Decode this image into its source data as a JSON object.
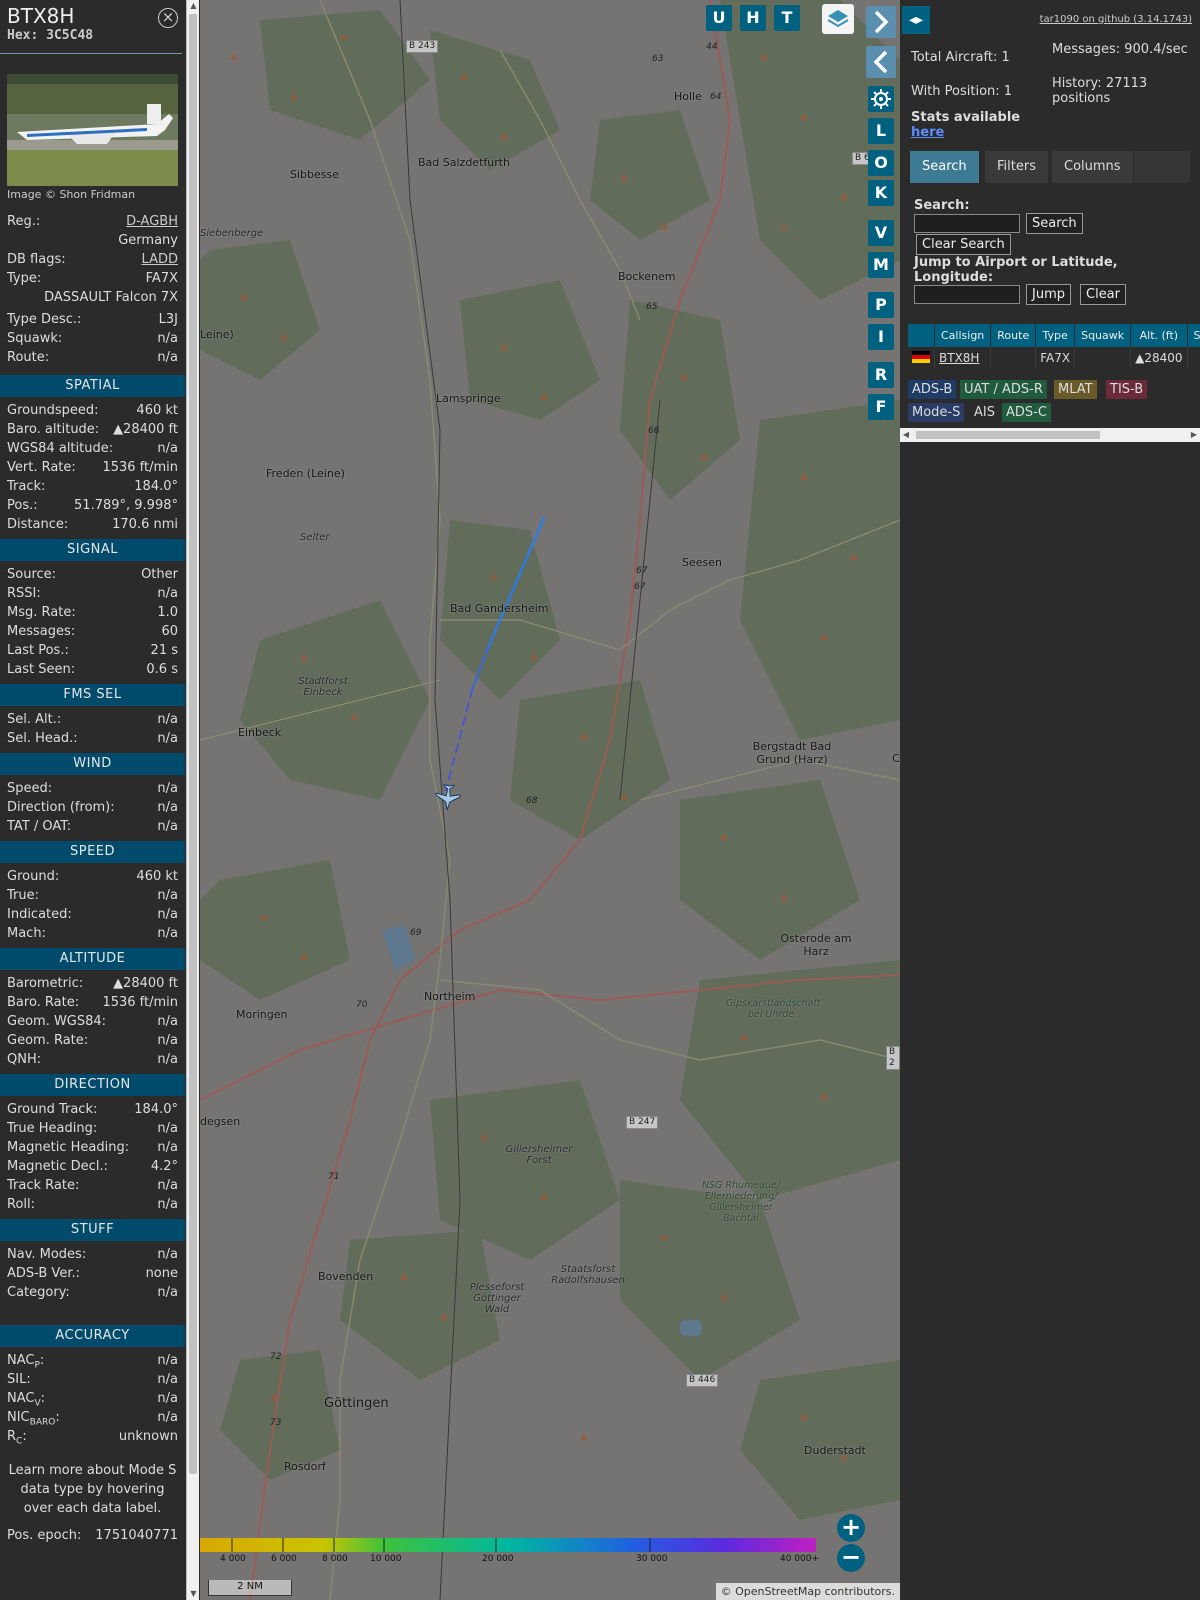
{
  "aircraft": {
    "callsign": "BTX8H",
    "hex": "Hex: 3C5C48",
    "image_credit": "Image © Shon Fridman",
    "registration_key": "Reg.:",
    "registration": "D-AGBH",
    "country": "Germany",
    "dbflags_key": "DB flags:",
    "dbflags": "LADD",
    "type_key": "Type:",
    "type": "FA7X",
    "type_name": "DASSAULT Falcon 7X",
    "type_desc_key": "Type Desc.:",
    "type_desc": "L3J",
    "squawk_key": "Squawk:",
    "squawk": "n/a",
    "route_key": "Route:",
    "route": "n/a"
  },
  "sections": {
    "spatial": {
      "title": "SPATIAL",
      "rows": [
        {
          "k": "Groundspeed:",
          "v": "460 kt"
        },
        {
          "k": "Baro. altitude:",
          "v": "▲28400 ft"
        },
        {
          "k": "WGS84 altitude:",
          "v": "n/a"
        },
        {
          "k": "Vert. Rate:",
          "v": "1536 ft/min"
        },
        {
          "k": "Track:",
          "v": "184.0°"
        },
        {
          "k": "Pos.:",
          "v": "51.789°, 9.998°"
        },
        {
          "k": "Distance:",
          "v": "170.6 nmi"
        }
      ]
    },
    "signal": {
      "title": "SIGNAL",
      "rows": [
        {
          "k": "Source:",
          "v": "Other"
        },
        {
          "k": "RSSI:",
          "v": "n/a"
        },
        {
          "k": "Msg. Rate:",
          "v": "1.0"
        },
        {
          "k": "Messages:",
          "v": "60"
        },
        {
          "k": "Last Pos.:",
          "v": "21 s"
        },
        {
          "k": "Last Seen:",
          "v": "0.6 s"
        }
      ]
    },
    "fms": {
      "title": "FMS SEL",
      "rows": [
        {
          "k": "Sel. Alt.:",
          "v": "n/a"
        },
        {
          "k": "Sel. Head.:",
          "v": "n/a"
        }
      ]
    },
    "wind": {
      "title": "WIND",
      "rows": [
        {
          "k": "Speed:",
          "v": "n/a"
        },
        {
          "k": "Direction (from):",
          "v": "n/a"
        },
        {
          "k": "TAT / OAT:",
          "v": "n/a"
        }
      ]
    },
    "speed": {
      "title": "SPEED",
      "rows": [
        {
          "k": "Ground:",
          "v": "460 kt"
        },
        {
          "k": "True:",
          "v": "n/a"
        },
        {
          "k": "Indicated:",
          "v": "n/a"
        },
        {
          "k": "Mach:",
          "v": "n/a"
        }
      ]
    },
    "altitude": {
      "title": "ALTITUDE",
      "rows": [
        {
          "k": "Barometric:",
          "v": "▲28400 ft"
        },
        {
          "k": "Baro. Rate:",
          "v": "1536 ft/min"
        },
        {
          "k": "Geom. WGS84:",
          "v": "n/a"
        },
        {
          "k": "Geom. Rate:",
          "v": "n/a"
        },
        {
          "k": "QNH:",
          "v": "n/a"
        }
      ]
    },
    "direction": {
      "title": "DIRECTION",
      "rows": [
        {
          "k": "Ground Track:",
          "v": "184.0°"
        },
        {
          "k": "True Heading:",
          "v": "n/a"
        },
        {
          "k": "Magnetic Heading:",
          "v": "n/a"
        },
        {
          "k": "Magnetic Decl.:",
          "v": "4.2°"
        },
        {
          "k": "Track Rate:",
          "v": "n/a"
        },
        {
          "k": "Roll:",
          "v": "n/a"
        }
      ]
    },
    "stuff": {
      "title": "STUFF",
      "rows": [
        {
          "k": "Nav. Modes:",
          "v": "n/a"
        },
        {
          "k": "ADS-B Ver.:",
          "v": "none"
        },
        {
          "k": "Category:",
          "v": "n/a"
        }
      ]
    },
    "accuracy": {
      "title": "ACCURACY",
      "rows": [
        {
          "k": "NAC",
          "sub": "P",
          "tail": ":",
          "v": "n/a"
        },
        {
          "k": "SIL:",
          "sub": "",
          "tail": "",
          "v": "n/a"
        },
        {
          "k": "NAC",
          "sub": "V",
          "tail": ":",
          "v": "n/a"
        },
        {
          "k": "NIC",
          "sub": "BARO",
          "tail": ":",
          "v": "n/a"
        },
        {
          "k": "R",
          "sub": "C",
          "tail": ":",
          "v": "unknown"
        }
      ]
    }
  },
  "learn_more": "Learn more about Mode S data type by hovering over each data label.",
  "pos_epoch_key": "Pos. epoch:",
  "pos_epoch": "1751040771",
  "map": {
    "buttons_top": [
      "U",
      "H",
      "T"
    ],
    "buttons_side": [
      "L",
      "O",
      "K",
      "V",
      "M",
      "P",
      "I",
      "R",
      "F"
    ],
    "places": [
      {
        "name": "Holle",
        "cls": ""
      },
      {
        "name": "Bad Salzdetfurth",
        "cls": ""
      },
      {
        "name": "Sibbesse",
        "cls": ""
      },
      {
        "name": "Siebenberge",
        "cls": "italic"
      },
      {
        "name": "Bockenem",
        "cls": ""
      },
      {
        "name": "Leine)",
        "cls": ""
      },
      {
        "name": "Lamspringe",
        "cls": ""
      },
      {
        "name": "Freden (Leine)",
        "cls": ""
      },
      {
        "name": "Selter",
        "cls": "italic"
      },
      {
        "name": "Seesen",
        "cls": ""
      },
      {
        "name": "Bad Gandersheim",
        "cls": ""
      },
      {
        "name": "Stadtforst Einbeck",
        "cls": "italic"
      },
      {
        "name": "Einbeck",
        "cls": ""
      },
      {
        "name": "Bergstadt Bad Grund (Harz)",
        "cls": ""
      },
      {
        "name": "Osterode am Harz",
        "cls": ""
      },
      {
        "name": "Northeim",
        "cls": ""
      },
      {
        "name": "Moringen",
        "cls": ""
      },
      {
        "name": "Gipskarstlandschaft bei Uhrde",
        "cls": "green"
      },
      {
        "name": "degsen",
        "cls": ""
      },
      {
        "name": "Gillersheimer Forst",
        "cls": "italic"
      },
      {
        "name": "NSG Rhumeaue/ Ellerniederung/ Gillersheimer Bachtal",
        "cls": "green"
      },
      {
        "name": "Staatsforst Radolfshausen",
        "cls": "italic"
      },
      {
        "name": "Plesseforst Göttinger Wald",
        "cls": "italic"
      },
      {
        "name": "Bovenden",
        "cls": ""
      },
      {
        "name": "Göttingen",
        "cls": "big"
      },
      {
        "name": "Rosdorf",
        "cls": ""
      },
      {
        "name": "Duderstadt",
        "cls": ""
      },
      {
        "name": "C",
        "cls": ""
      }
    ],
    "roads": [
      "B 243",
      "B 6",
      "B 247",
      "B 446",
      "B 2"
    ],
    "road_numbers": [
      "63",
      "64",
      "65",
      "66",
      "67",
      "67",
      "68",
      "69",
      "70",
      "71",
      "72",
      "73",
      "44"
    ],
    "alt_labels": [
      "4 000",
      "6 000",
      "8 000",
      "10 000",
      "20 000",
      "30 000",
      "40 000+"
    ],
    "scale": "2 NM",
    "attribution": "© OpenStreetMap contributors."
  },
  "right": {
    "github": "tar1090 on github (3.14.1743)",
    "total_aircraft": "Total Aircraft: 1",
    "with_position": "With Position: 1",
    "messages": "Messages: 900.4/sec",
    "history": "History: 27113 positions",
    "stats": "Stats available",
    "stats_link": "here",
    "tabs": [
      "Search",
      "Filters",
      "Columns"
    ],
    "search_label": "Search:",
    "search_button": "Search",
    "clear_search_button": "Clear Search",
    "jump_label": "Jump to Airport or Latitude, Longitude:",
    "jump_button": "Jump",
    "clear_button": "Clear",
    "table_headers": [
      "",
      "Callsign",
      "Route",
      "Type",
      "Squawk",
      "Alt. (ft)",
      "Spd"
    ],
    "table_row": {
      "callsign": "BTX8H",
      "route": "",
      "type": "FA7X",
      "squawk": "",
      "alt": "▲28400",
      "spd": ""
    },
    "legend": [
      {
        "label": "ADS-B",
        "color": "#1e3c66"
      },
      {
        "label": "UAT / ADS-R",
        "color": "#1f5b3c"
      },
      {
        "label": "MLAT",
        "color": "#6a5a2a"
      },
      {
        "label": "TIS-B",
        "color": "#6a2a3a"
      },
      {
        "label": "Mode-S",
        "color": "#2a3c66"
      },
      {
        "label": "AIS",
        "color": "#2b2b2b"
      },
      {
        "label": "ADS-C",
        "color": "#1f5b3c"
      }
    ]
  }
}
